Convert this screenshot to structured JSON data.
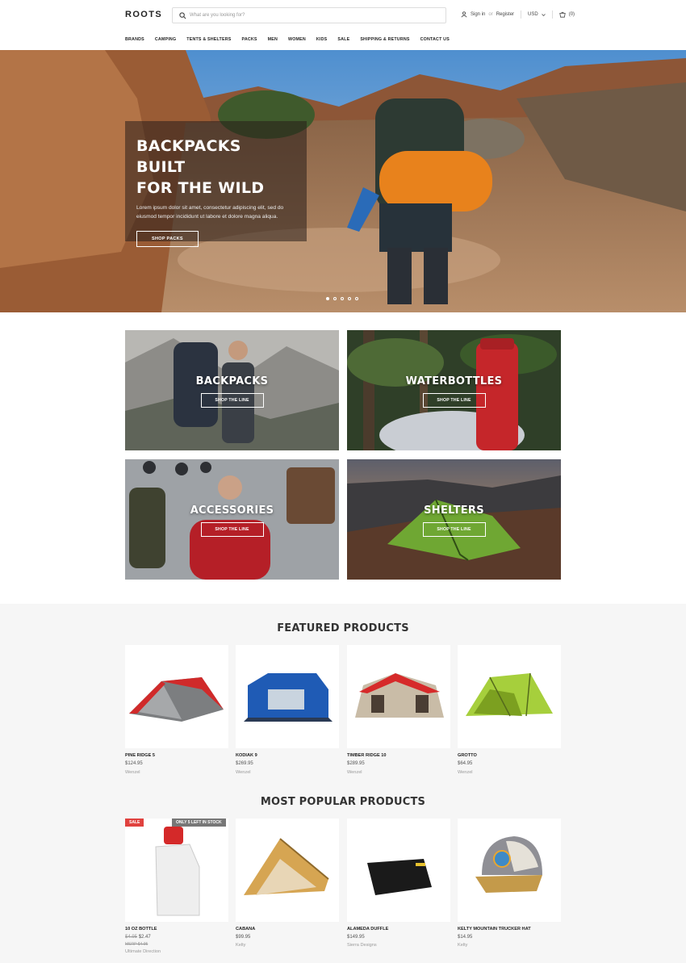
{
  "header": {
    "logo": "ROOTS",
    "search_placeholder": "What are you looking for?",
    "sign_in": "Sign in",
    "or": "or",
    "register": "Register",
    "currency": "USD",
    "cart": "(0)"
  },
  "nav": [
    "BRANDS",
    "CAMPING",
    "TENTS & SHELTERS",
    "PACKS",
    "MEN",
    "WOMEN",
    "KIDS",
    "SALE",
    "SHIPPING & RETURNS",
    "CONTACT US"
  ],
  "hero": {
    "title_line1": "BACKPACKS BUILT",
    "title_line2": "FOR THE WILD",
    "text": "Lorem ipsum dolor sit amet, consectetur adipiscing elit, sed do eiusmod tempor incididunt ut labore et dolore magna aliqua.",
    "button": "SHOP PACKS",
    "slide_count": 5,
    "active_slide": 1
  },
  "categories": [
    {
      "label": "BACKPACKS",
      "button": "SHOP THE LINE"
    },
    {
      "label": "WATERBOTTLES",
      "button": "SHOP THE LINE"
    },
    {
      "label": "ACCESSORIES",
      "button": "SHOP THE LINE"
    },
    {
      "label": "SHELTERS",
      "button": "SHOP THE LINE"
    }
  ],
  "featured": {
    "title": "FEATURED PRODUCTS",
    "items": [
      {
        "name": "PINE RIDGE 5",
        "price": "$124.95",
        "brand": "Wenzel"
      },
      {
        "name": "KODIAK 9",
        "price": "$269.95",
        "brand": "Wenzel"
      },
      {
        "name": "TIMBER RIDGE 10",
        "price": "$289.95",
        "brand": "Wenzel"
      },
      {
        "name": "GROTTO",
        "price": "$64.95",
        "brand": "Wenzel"
      }
    ]
  },
  "popular": {
    "title": "MOST POPULAR PRODUCTS",
    "sale_badge": "SALE",
    "stock_badge": "ONLY 5 LEFT IN STOCK",
    "items": [
      {
        "name": "10 OZ BOTTLE",
        "old_price": "$4.95",
        "price": "$2.47",
        "msrp": "MSRP $4.95",
        "brand": "Ultimate Direction"
      },
      {
        "name": "CABANA",
        "price": "$99.95",
        "brand": "Kelty"
      },
      {
        "name": "ALAMEDA DUFFLE",
        "price": "$149.95",
        "brand": "Sierra Designs"
      },
      {
        "name": "KELTY MOUNTAIN TRUCKER HAT",
        "price": "$14.95",
        "brand": "Kelty"
      }
    ]
  },
  "colors": {
    "sale": "#e0413e",
    "stock": "#777777",
    "section_bg": "#f6f6f6"
  }
}
